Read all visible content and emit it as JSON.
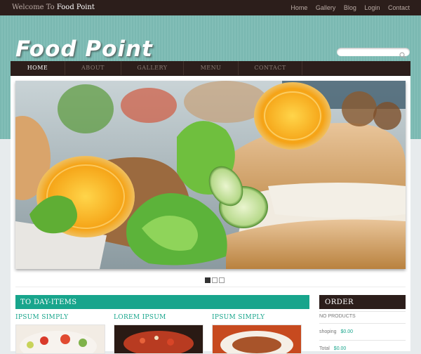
{
  "topbar": {
    "welcome_prefix": "Welcome To",
    "welcome_brand": "Food Point",
    "links": [
      "Home",
      "Gallery",
      "Blog",
      "Login",
      "Contact"
    ]
  },
  "logo": "Food Point",
  "search": {
    "placeholder": ""
  },
  "nav": {
    "items": [
      "HOME",
      "ABOUT",
      "GALLERY",
      "MENU",
      "CONTACT"
    ]
  },
  "slider": {
    "slides_count": 3,
    "active_slide": 1
  },
  "today": {
    "header": "TO DAY-ITEMS",
    "columns": [
      "IPSUM SIMPLY",
      "LOREM IPSUM",
      "IPSUM SIMPLY"
    ]
  },
  "order": {
    "header": "ORDER",
    "no_products": "NO PRODUCTS",
    "shipping_label": "shoping",
    "shipping_value": "$0.00",
    "total_label": "Total",
    "total_value": "$0.00"
  },
  "colors": {
    "accent": "#18a58c",
    "dark": "#2c1e1b",
    "header_bg": "#7ab8b1"
  }
}
